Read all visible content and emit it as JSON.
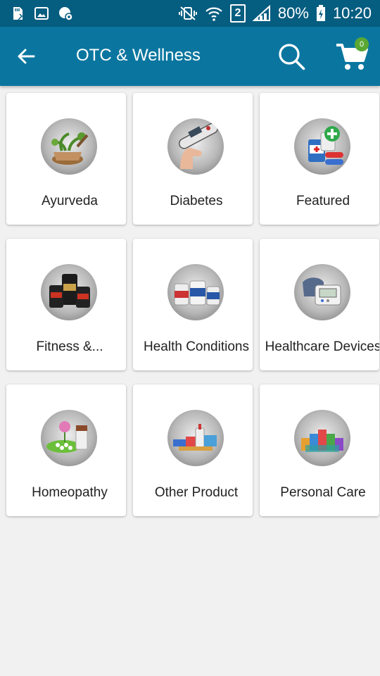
{
  "status_bar": {
    "battery": "80%",
    "time": "10:20",
    "sim": "2",
    "colors": {
      "background": "#055d80"
    }
  },
  "app_bar": {
    "title": "OTC & Wellness",
    "cart_count": "0",
    "colors": {
      "background": "#0a76a0",
      "badge": "#5aa833"
    }
  },
  "categories": [
    {
      "label": "Ayurveda",
      "icon": "ayurveda-herbs-icon"
    },
    {
      "label": "Diabetes",
      "icon": "glucometer-icon"
    },
    {
      "label": "Featured",
      "icon": "medicine-bottles-icon"
    },
    {
      "label": "Fitness &...",
      "icon": "supplement-tubs-icon"
    },
    {
      "label": "Health Conditions",
      "icon": "pill-bottles-icon"
    },
    {
      "label": "Healthcare Devices",
      "icon": "bp-monitor-icon"
    },
    {
      "label": "Homeopathy",
      "icon": "homeopathy-pills-icon"
    },
    {
      "label": "Other Product",
      "icon": "assorted-products-icon"
    },
    {
      "label": "Personal Care",
      "icon": "personal-care-products-icon"
    }
  ]
}
